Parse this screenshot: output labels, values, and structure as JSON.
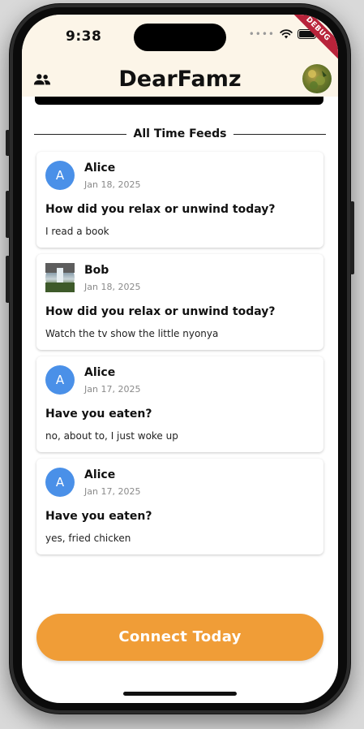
{
  "status_bar": {
    "time": "9:38",
    "debug_label": "DEBUG"
  },
  "header": {
    "title": "DearFamz"
  },
  "section": {
    "title": "All Time Feeds"
  },
  "feeds": [
    {
      "avatar_letter": "A",
      "name": "Alice",
      "date": "Jan 18, 2025",
      "question": "How did you relax or unwind today?",
      "answer": "I read a book"
    },
    {
      "avatar_letter": "",
      "name": "Bob",
      "date": "Jan 18, 2025",
      "question": "How did you relax or unwind today?",
      "answer": "Watch the tv show the little nyonya"
    },
    {
      "avatar_letter": "A",
      "name": "Alice",
      "date": "Jan 17, 2025",
      "question": "Have you eaten?",
      "answer": "no, about to, I just woke up"
    },
    {
      "avatar_letter": "A",
      "name": "Alice",
      "date": "Jan 17, 2025",
      "question": "Have you eaten?",
      "answer": "yes, fried chicken"
    }
  ],
  "footer": {
    "connect_label": "Connect Today"
  },
  "colors": {
    "header_bg": "#fcf5e8",
    "avatar_blue": "#4a90e8",
    "accent_orange": "#f09d37"
  }
}
